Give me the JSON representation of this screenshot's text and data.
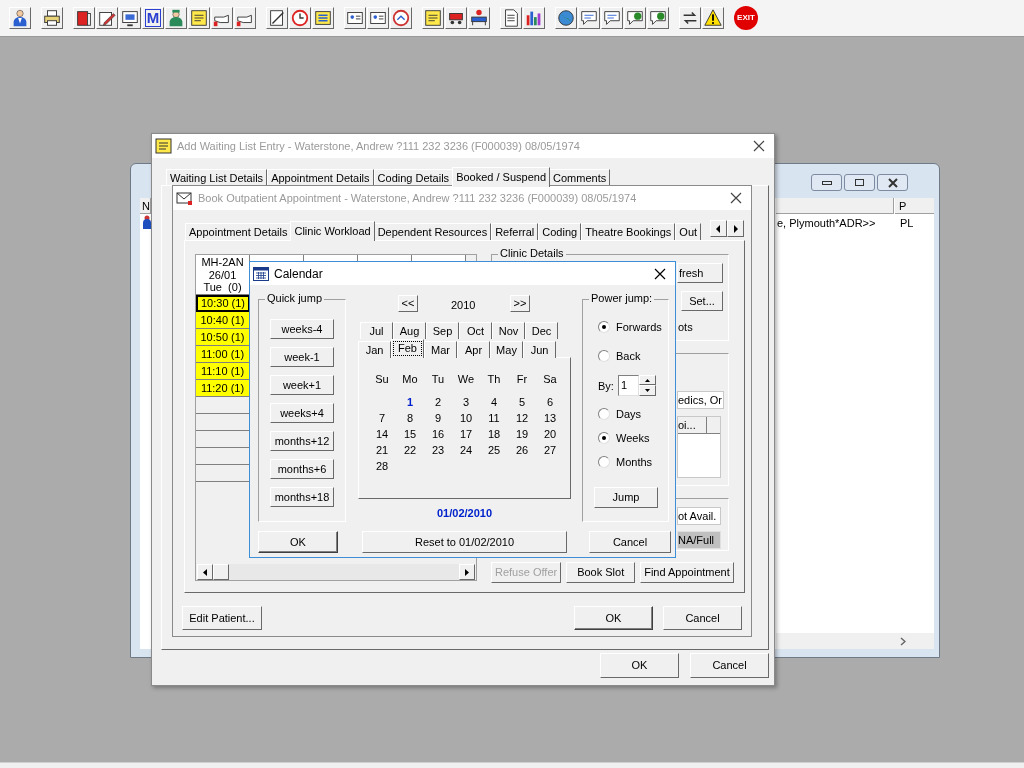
{
  "toolbar": {
    "mail_letter": "M",
    "exit_label": "EXIT"
  },
  "background_window": {
    "header_left": "N",
    "header_right": "P",
    "row": {
      "address": "e, Plymouth*ADR>>",
      "code": "PL"
    }
  },
  "waiting_list_window": {
    "title": "Add Waiting List Entry - Waterstone, Andrew ?111 232 3236 (F000039) 08/05/1974",
    "tabs": [
      {
        "label": "Waiting List Details",
        "selected": false
      },
      {
        "label": "Appointment Details",
        "selected": false
      },
      {
        "label": "Coding Details",
        "selected": false
      },
      {
        "label": "Booked / Suspend",
        "selected": true
      },
      {
        "label": "Comments",
        "selected": false
      }
    ],
    "buttons": [
      "OK",
      "Cancel"
    ]
  },
  "booking_window": {
    "title": "Book Outpatient Appointment - Waterstone, Andrew ?111 232 3236 (F000039) 08/05/1974",
    "tabs": [
      {
        "label": "Appointment Details",
        "selected": false
      },
      {
        "label": "Clinic Workload",
        "selected": true
      },
      {
        "label": "Dependent Resources",
        "selected": false
      },
      {
        "label": "Referral",
        "selected": false
      },
      {
        "label": "Coding",
        "selected": false
      },
      {
        "label": "Theatre Bookings",
        "selected": false
      },
      {
        "label": "Out",
        "selected": false
      }
    ],
    "workload": {
      "header": [
        "MH-2AN",
        "26/01",
        "Tue  (0)"
      ],
      "slots": [
        {
          "time": "10:30 (1)",
          "selected": true
        },
        {
          "time": "10:40 (1)",
          "selected": false
        },
        {
          "time": "10:50 (1)",
          "selected": false
        },
        {
          "time": "11:00 (1)",
          "selected": false
        },
        {
          "time": "11:10 (1)",
          "selected": false
        },
        {
          "time": "11:20 (1)",
          "selected": false
        }
      ]
    },
    "clinic_details": {
      "label": "Clinic Details",
      "refresh_button": "fresh",
      "set_button": "Set...",
      "slots_text": "ots"
    },
    "specialty_field": "edics, Or",
    "list_header": "oi...",
    "availability": {
      "not_available": "ot Avail.",
      "full": "NA/Full"
    },
    "actions": [
      {
        "label": "Refuse Offer",
        "disabled": true
      },
      {
        "label": "Book Slot",
        "disabled": false
      },
      {
        "label": "Find Appointment",
        "disabled": false
      }
    ],
    "edit_patient": "Edit Patient...",
    "buttons": [
      "OK",
      "Cancel"
    ]
  },
  "calendar": {
    "title": "Calendar",
    "quick_jump_label": "Quick jump",
    "quick_jump": [
      "weeks-4",
      "week-1",
      "week+1",
      "weeks+4",
      "months+12",
      "months+6",
      "months+18"
    ],
    "prev_year": "<<",
    "year": "2010",
    "next_year": ">>",
    "month_tab_rows": [
      [
        {
          "label": "Jul",
          "selected": false
        },
        {
          "label": "Aug",
          "selected": false
        },
        {
          "label": "Sep",
          "selected": false
        },
        {
          "label": "Oct",
          "selected": false
        },
        {
          "label": "Nov",
          "selected": false
        },
        {
          "label": "Dec",
          "selected": false
        }
      ],
      [
        {
          "label": "Jan",
          "selected": false
        },
        {
          "label": "Feb",
          "selected": true
        },
        {
          "label": "Mar",
          "selected": false
        },
        {
          "label": "Apr",
          "selected": false
        },
        {
          "label": "May",
          "selected": false
        },
        {
          "label": "Jun",
          "selected": false
        }
      ]
    ],
    "weekdays": [
      "Su",
      "Mo",
      "Tu",
      "We",
      "Th",
      "Fr",
      "Sa"
    ],
    "weeks": [
      [
        {
          "day": "1",
          "selected": true
        },
        {
          "day": "2",
          "selected": false
        },
        {
          "day": "3",
          "selected": false
        },
        {
          "day": "4",
          "selected": false
        },
        {
          "day": "5",
          "selected": false
        },
        {
          "day": "6",
          "selected": false
        }
      ],
      [
        {
          "day": "7",
          "selected": false
        },
        {
          "day": "8",
          "selected": false
        },
        {
          "day": "9",
          "selected": false
        },
        {
          "day": "10",
          "selected": false
        },
        {
          "day": "11",
          "selected": false
        },
        {
          "day": "12",
          "selected": false
        },
        {
          "day": "13",
          "selected": false
        }
      ],
      [
        {
          "day": "14",
          "selected": false
        },
        {
          "day": "15",
          "selected": false
        },
        {
          "day": "16",
          "selected": false
        },
        {
          "day": "17",
          "selected": false
        },
        {
          "day": "18",
          "selected": false
        },
        {
          "day": "19",
          "selected": false
        },
        {
          "day": "20",
          "selected": false
        }
      ],
      [
        {
          "day": "21",
          "selected": false
        },
        {
          "day": "22",
          "selected": false
        },
        {
          "day": "23",
          "selected": false
        },
        {
          "day": "24",
          "selected": false
        },
        {
          "day": "25",
          "selected": false
        },
        {
          "day": "26",
          "selected": false
        },
        {
          "day": "27",
          "selected": false
        }
      ],
      [
        {
          "day": "28",
          "selected": false
        }
      ]
    ],
    "selected_date": "01/02/2010",
    "power_jump_label": "Power jump:",
    "directions": [
      {
        "label": "Forwards",
        "selected": true
      },
      {
        "label": "Back",
        "selected": false
      }
    ],
    "by_label": "By:",
    "by_value": "1",
    "units": [
      {
        "label": "Days",
        "selected": false
      },
      {
        "label": "Weeks",
        "selected": true
      },
      {
        "label": "Months",
        "selected": false
      }
    ],
    "jump_button": "Jump",
    "ok_button": "OK",
    "reset_button": "Reset to 01/02/2010",
    "cancel_button": "Cancel"
  }
}
